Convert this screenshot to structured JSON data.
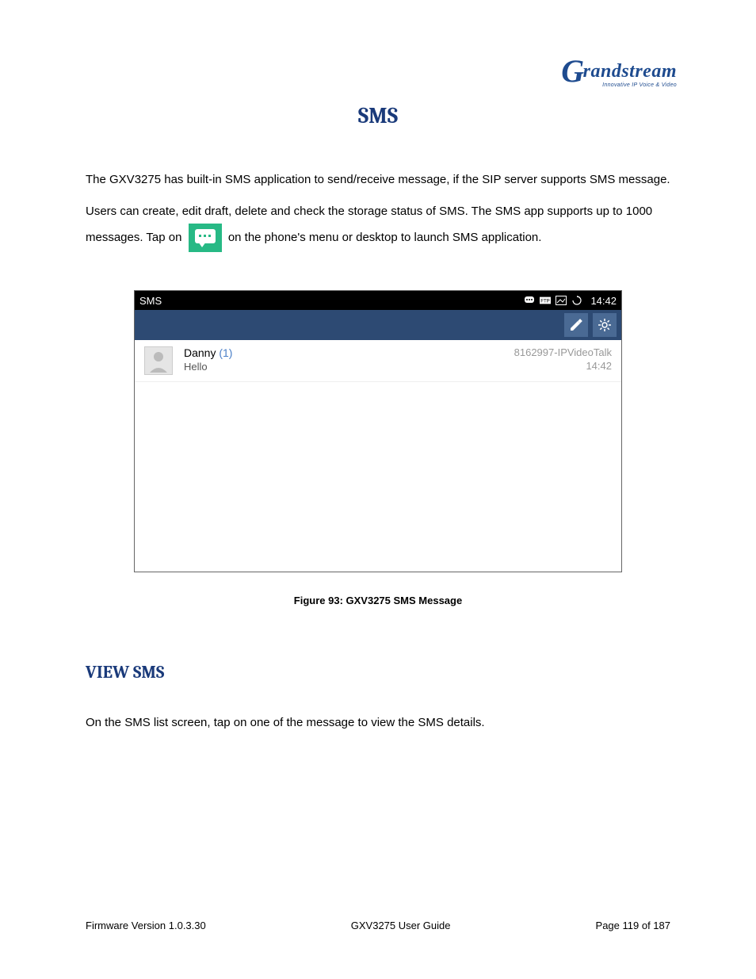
{
  "brand": {
    "name": "Grandstream",
    "tagline": "Innovative IP Voice & Video"
  },
  "title": "SMS",
  "para1": "The GXV3275 has built-in SMS application to send/receive message, if the SIP server supports SMS message.",
  "para2a": "Users can create, edit draft, delete and check the storage status of SMS. The SMS app supports up to 1000",
  "para2b": "messages. Tap on",
  "para2c": "on the phone's menu or desktop to launch SMS application.",
  "screenshot": {
    "statusbar": {
      "title": "SMS",
      "time": "14:42"
    },
    "messages": [
      {
        "name": "Danny",
        "count": "(1)",
        "preview": "Hello",
        "source": "8162997-IPVideoTalk",
        "time": "14:42"
      }
    ]
  },
  "caption": "Figure 93: GXV3275 SMS Message",
  "section_view": "VIEW SMS",
  "para3": "On the SMS list screen, tap on one of the message to view the SMS details.",
  "footer": {
    "left": "Firmware Version 1.0.3.30",
    "center": "GXV3275 User Guide",
    "right": "Page 119 of 187"
  }
}
